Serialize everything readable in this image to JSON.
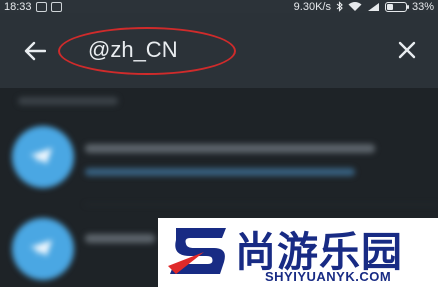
{
  "status_bar": {
    "time": "18:33",
    "network_speed": "9.30K/s",
    "battery": "33%",
    "battery_level": 0.33,
    "icons": [
      "notification-icon",
      "app-icon",
      "bluetooth-icon",
      "wifi-icon",
      "signal-icon",
      "battery-icon"
    ]
  },
  "search_header": {
    "back_icon": "arrow-left-icon",
    "query": "@zh_CN",
    "close_icon": "close-icon",
    "annotation_color": "#cf2b2b"
  },
  "watermark": {
    "cn_text": "尚游乐园",
    "en_text": "SHYIYUANYK.COM",
    "color": "#182b84",
    "accent": "#e02a2a"
  },
  "colors": {
    "header_bg": "#2b3238",
    "page_bg": "#1e2327",
    "avatar": "#4aa7e3"
  }
}
